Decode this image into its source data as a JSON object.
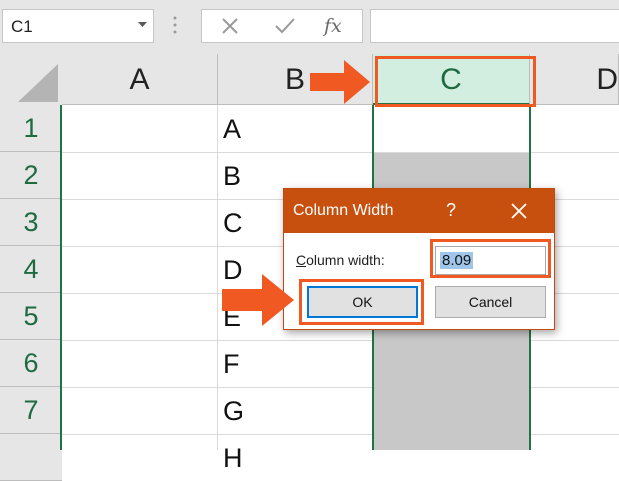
{
  "formula_bar": {
    "name_box": "C1",
    "cancel_icon": "x-icon",
    "enter_icon": "checkmark-icon",
    "fx_label": "fx",
    "formula": ""
  },
  "grid": {
    "columns": [
      "A",
      "B",
      "C",
      "D"
    ],
    "selected_column": "C",
    "rows": [
      "1",
      "2",
      "3",
      "4",
      "5",
      "6",
      "7"
    ],
    "column_b_values": [
      "A",
      "B",
      "C",
      "D",
      "E",
      "F",
      "G",
      "H"
    ]
  },
  "dialog": {
    "title": "Column Width",
    "help": "?",
    "field_label_underlined": "C",
    "field_label_rest": "olumn width:",
    "value": "8.09",
    "ok_label": "OK",
    "cancel_label": "Cancel"
  },
  "colors": {
    "dialog_title_bg": "#c8500f",
    "annotation": "#f05a22",
    "selection_green": "#217346"
  }
}
